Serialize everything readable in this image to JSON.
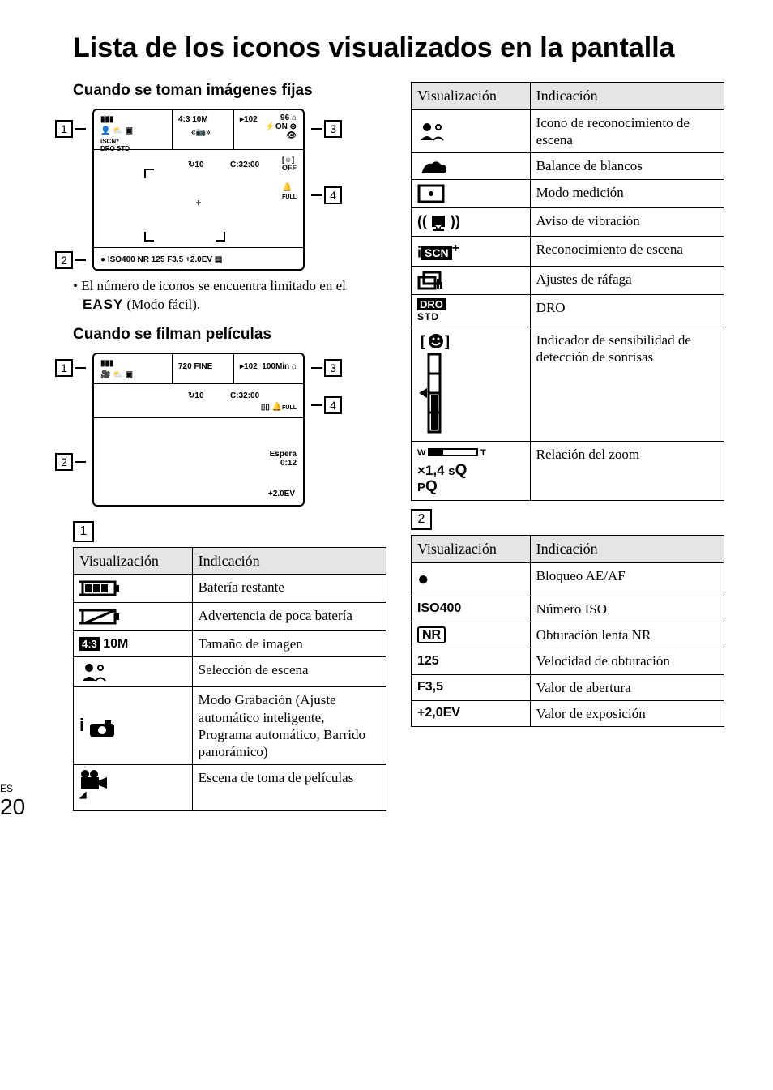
{
  "page": {
    "lang": "ES",
    "number": "20"
  },
  "title": "Lista de los iconos visualizados en la pantalla",
  "heading_stills": "Cuando se toman imágenes fijas",
  "heading_movies": "Cuando se filman películas",
  "note": {
    "prefix": "• El número de iconos se encuentra limitado en el ",
    "easy": "EASY",
    "suffix": " (Modo fácil)."
  },
  "lcd_stills": {
    "size": "4:3 10M",
    "folder": "102",
    "remain": "96",
    "timer": "10",
    "rec_time": "C:32:00",
    "af_tl": "┌",
    "af_tr": "┐",
    "af_bl": "└",
    "af_br": "┘",
    "bottom": "ISO400    NR   125    F3.5   +2.0EV",
    "callouts": {
      "a": "1",
      "b": "2",
      "c": "3",
      "d": "4"
    }
  },
  "lcd_movies": {
    "mode": "720 FINE",
    "folder": "102",
    "remain": "100Min",
    "timer": "10",
    "rec_time": "C:32:00",
    "standby": "Espera",
    "elapsed": "0:12",
    "ev": "+2.0EV",
    "callouts": {
      "a": "1",
      "b": "2",
      "c": "3",
      "d": "4"
    }
  },
  "section_labels": {
    "s1": "1",
    "s2": "2"
  },
  "hdr": {
    "vis": "Visualización",
    "ind": "Indicación"
  },
  "table1": [
    {
      "icon": "battery",
      "text": "Batería restante"
    },
    {
      "icon": "battery-low",
      "text": "Advertencia de poca batería"
    },
    {
      "icon": "img-size",
      "label": "4:3 10M",
      "text": "Tamaño de imagen"
    },
    {
      "icon": "scene-person",
      "text": "Selección de escena"
    },
    {
      "icon": "rec-mode",
      "label": "i",
      "text": "Modo Grabación (Ajuste automático inteligente, Programa automático, Barrido panorámico)"
    },
    {
      "icon": "movie-scene",
      "text": "Escena de toma de películas"
    },
    {
      "icon": "face-detect",
      "text": "Icono de reconocimiento de escena"
    },
    {
      "icon": "wb-cloud",
      "text": "Balance de blancos"
    },
    {
      "icon": "metering",
      "text": "Modo medición"
    },
    {
      "icon": "vibration",
      "text": "Aviso de vibración"
    },
    {
      "icon": "scn-plus",
      "label": "i SCN⁺",
      "text": "Reconocimiento de escena"
    },
    {
      "icon": "burst",
      "text": "Ajustes de ráfaga"
    },
    {
      "icon": "dro",
      "label": "DRO\nSTD",
      "text": "DRO"
    },
    {
      "icon": "smile-sens",
      "text": "Indicador de sensibilidad de detección de sonrisas"
    },
    {
      "icon": "zoom-ratio",
      "label": "×1,4 sQ",
      "text": "Relación del zoom"
    }
  ],
  "table2": [
    {
      "icon": "ae-dot",
      "label": "●",
      "text": "Bloqueo AE/AF"
    },
    {
      "icon": "iso",
      "label": "ISO400",
      "text": "Número ISO"
    },
    {
      "icon": "nr",
      "label": "NR",
      "text": "Obturación lenta NR"
    },
    {
      "icon": "shutter",
      "label": "125",
      "text": "Velocidad de obturación"
    },
    {
      "icon": "fval",
      "label": "F3,5",
      "text": "Valor de abertura"
    },
    {
      "icon": "ev",
      "label": "+2,0EV",
      "text": "Valor de exposición"
    }
  ]
}
